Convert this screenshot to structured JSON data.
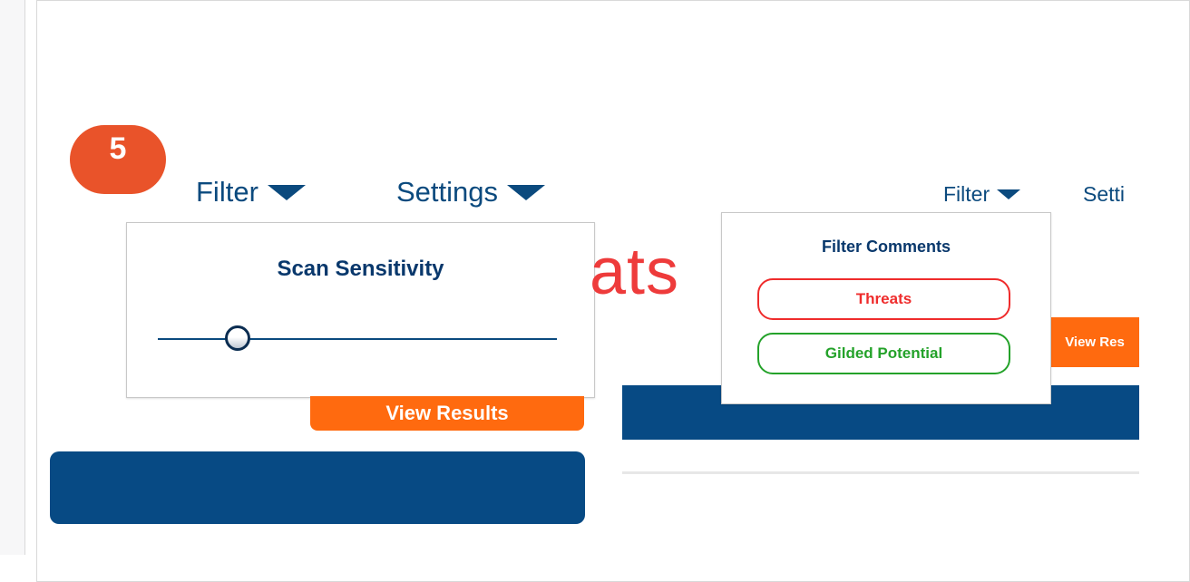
{
  "step_badge": {
    "number": "5"
  },
  "left_preview": {
    "filter_tab": {
      "label": "Filter"
    },
    "settings_tab": {
      "label": "Settings"
    },
    "view_results_button": {
      "label": "View Results"
    },
    "settings_popup": {
      "title": "Scan Sensitivity",
      "slider_level": 0.2
    }
  },
  "right_preview": {
    "partial_title": "ats",
    "filter_tab": {
      "label": "Filter"
    },
    "settings_tab": {
      "label": "Setti"
    },
    "view_results_button": {
      "label": "View Res"
    },
    "filter_popup": {
      "title": "Filter Comments",
      "options": [
        {
          "label": "Threats",
          "color": "#ef2c2c"
        },
        {
          "label": "Gilded Potential",
          "color": "#24a22a"
        }
      ]
    }
  },
  "colors": {
    "accent_orange": "#ff6a0f",
    "badge_orange": "#e9532a",
    "nav_blue": "#0b4a7e",
    "bar_blue": "#074a84",
    "title_red": "#ee3b3b"
  },
  "icons": [
    "caret-down-icon",
    "slider-thumb"
  ]
}
